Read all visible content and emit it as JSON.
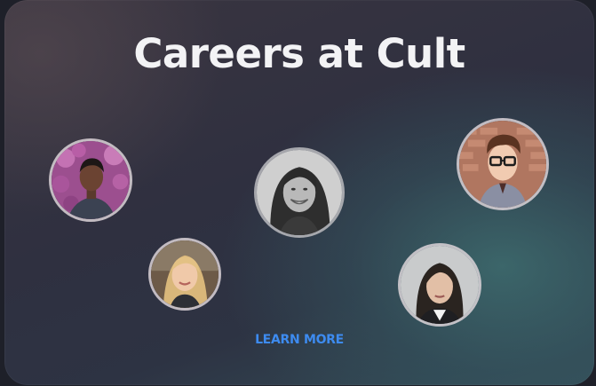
{
  "card": {
    "title": "Careers at Cult",
    "cta_label": "LEARN MORE",
    "accent_color": "#3d8bf0"
  },
  "avatars": [
    {
      "name": "team-member-avatar-1",
      "description_icon": "person-photo"
    },
    {
      "name": "team-member-avatar-2",
      "description_icon": "person-photo"
    },
    {
      "name": "team-member-avatar-3",
      "description_icon": "person-photo"
    },
    {
      "name": "team-member-avatar-4",
      "description_icon": "person-photo"
    },
    {
      "name": "team-member-avatar-5",
      "description_icon": "person-photo"
    }
  ]
}
